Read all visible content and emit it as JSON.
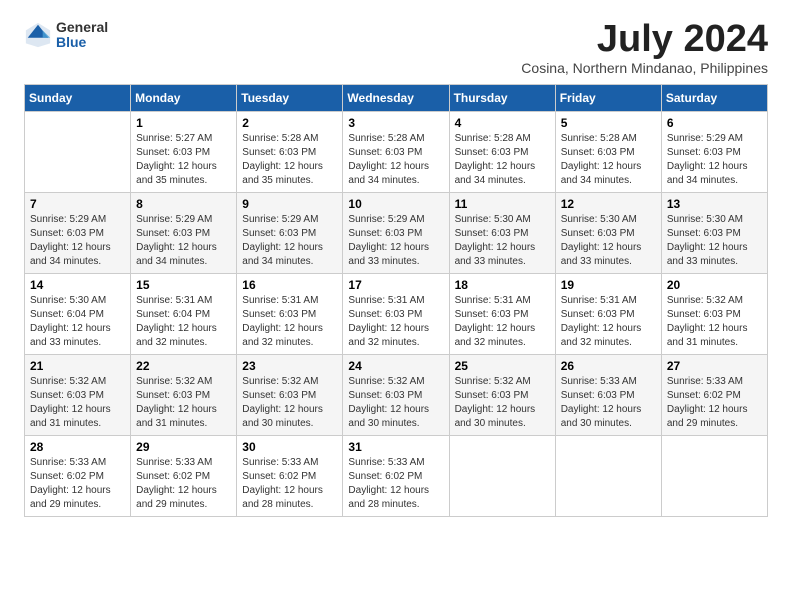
{
  "logo": {
    "general": "General",
    "blue": "Blue"
  },
  "title": "July 2024",
  "subtitle": "Cosina, Northern Mindanao, Philippines",
  "days_of_week": [
    "Sunday",
    "Monday",
    "Tuesday",
    "Wednesday",
    "Thursday",
    "Friday",
    "Saturday"
  ],
  "weeks": [
    [
      {
        "day": "",
        "info": ""
      },
      {
        "day": "1",
        "info": "Sunrise: 5:27 AM\nSunset: 6:03 PM\nDaylight: 12 hours\nand 35 minutes."
      },
      {
        "day": "2",
        "info": "Sunrise: 5:28 AM\nSunset: 6:03 PM\nDaylight: 12 hours\nand 35 minutes."
      },
      {
        "day": "3",
        "info": "Sunrise: 5:28 AM\nSunset: 6:03 PM\nDaylight: 12 hours\nand 34 minutes."
      },
      {
        "day": "4",
        "info": "Sunrise: 5:28 AM\nSunset: 6:03 PM\nDaylight: 12 hours\nand 34 minutes."
      },
      {
        "day": "5",
        "info": "Sunrise: 5:28 AM\nSunset: 6:03 PM\nDaylight: 12 hours\nand 34 minutes."
      },
      {
        "day": "6",
        "info": "Sunrise: 5:29 AM\nSunset: 6:03 PM\nDaylight: 12 hours\nand 34 minutes."
      }
    ],
    [
      {
        "day": "7",
        "info": "Sunrise: 5:29 AM\nSunset: 6:03 PM\nDaylight: 12 hours\nand 34 minutes."
      },
      {
        "day": "8",
        "info": "Sunrise: 5:29 AM\nSunset: 6:03 PM\nDaylight: 12 hours\nand 34 minutes."
      },
      {
        "day": "9",
        "info": "Sunrise: 5:29 AM\nSunset: 6:03 PM\nDaylight: 12 hours\nand 34 minutes."
      },
      {
        "day": "10",
        "info": "Sunrise: 5:29 AM\nSunset: 6:03 PM\nDaylight: 12 hours\nand 33 minutes."
      },
      {
        "day": "11",
        "info": "Sunrise: 5:30 AM\nSunset: 6:03 PM\nDaylight: 12 hours\nand 33 minutes."
      },
      {
        "day": "12",
        "info": "Sunrise: 5:30 AM\nSunset: 6:03 PM\nDaylight: 12 hours\nand 33 minutes."
      },
      {
        "day": "13",
        "info": "Sunrise: 5:30 AM\nSunset: 6:03 PM\nDaylight: 12 hours\nand 33 minutes."
      }
    ],
    [
      {
        "day": "14",
        "info": "Sunrise: 5:30 AM\nSunset: 6:04 PM\nDaylight: 12 hours\nand 33 minutes."
      },
      {
        "day": "15",
        "info": "Sunrise: 5:31 AM\nSunset: 6:04 PM\nDaylight: 12 hours\nand 32 minutes."
      },
      {
        "day": "16",
        "info": "Sunrise: 5:31 AM\nSunset: 6:03 PM\nDaylight: 12 hours\nand 32 minutes."
      },
      {
        "day": "17",
        "info": "Sunrise: 5:31 AM\nSunset: 6:03 PM\nDaylight: 12 hours\nand 32 minutes."
      },
      {
        "day": "18",
        "info": "Sunrise: 5:31 AM\nSunset: 6:03 PM\nDaylight: 12 hours\nand 32 minutes."
      },
      {
        "day": "19",
        "info": "Sunrise: 5:31 AM\nSunset: 6:03 PM\nDaylight: 12 hours\nand 32 minutes."
      },
      {
        "day": "20",
        "info": "Sunrise: 5:32 AM\nSunset: 6:03 PM\nDaylight: 12 hours\nand 31 minutes."
      }
    ],
    [
      {
        "day": "21",
        "info": "Sunrise: 5:32 AM\nSunset: 6:03 PM\nDaylight: 12 hours\nand 31 minutes."
      },
      {
        "day": "22",
        "info": "Sunrise: 5:32 AM\nSunset: 6:03 PM\nDaylight: 12 hours\nand 31 minutes."
      },
      {
        "day": "23",
        "info": "Sunrise: 5:32 AM\nSunset: 6:03 PM\nDaylight: 12 hours\nand 30 minutes."
      },
      {
        "day": "24",
        "info": "Sunrise: 5:32 AM\nSunset: 6:03 PM\nDaylight: 12 hours\nand 30 minutes."
      },
      {
        "day": "25",
        "info": "Sunrise: 5:32 AM\nSunset: 6:03 PM\nDaylight: 12 hours\nand 30 minutes."
      },
      {
        "day": "26",
        "info": "Sunrise: 5:33 AM\nSunset: 6:03 PM\nDaylight: 12 hours\nand 30 minutes."
      },
      {
        "day": "27",
        "info": "Sunrise: 5:33 AM\nSunset: 6:02 PM\nDaylight: 12 hours\nand 29 minutes."
      }
    ],
    [
      {
        "day": "28",
        "info": "Sunrise: 5:33 AM\nSunset: 6:02 PM\nDaylight: 12 hours\nand 29 minutes."
      },
      {
        "day": "29",
        "info": "Sunrise: 5:33 AM\nSunset: 6:02 PM\nDaylight: 12 hours\nand 29 minutes."
      },
      {
        "day": "30",
        "info": "Sunrise: 5:33 AM\nSunset: 6:02 PM\nDaylight: 12 hours\nand 28 minutes."
      },
      {
        "day": "31",
        "info": "Sunrise: 5:33 AM\nSunset: 6:02 PM\nDaylight: 12 hours\nand 28 minutes."
      },
      {
        "day": "",
        "info": ""
      },
      {
        "day": "",
        "info": ""
      },
      {
        "day": "",
        "info": ""
      }
    ]
  ]
}
